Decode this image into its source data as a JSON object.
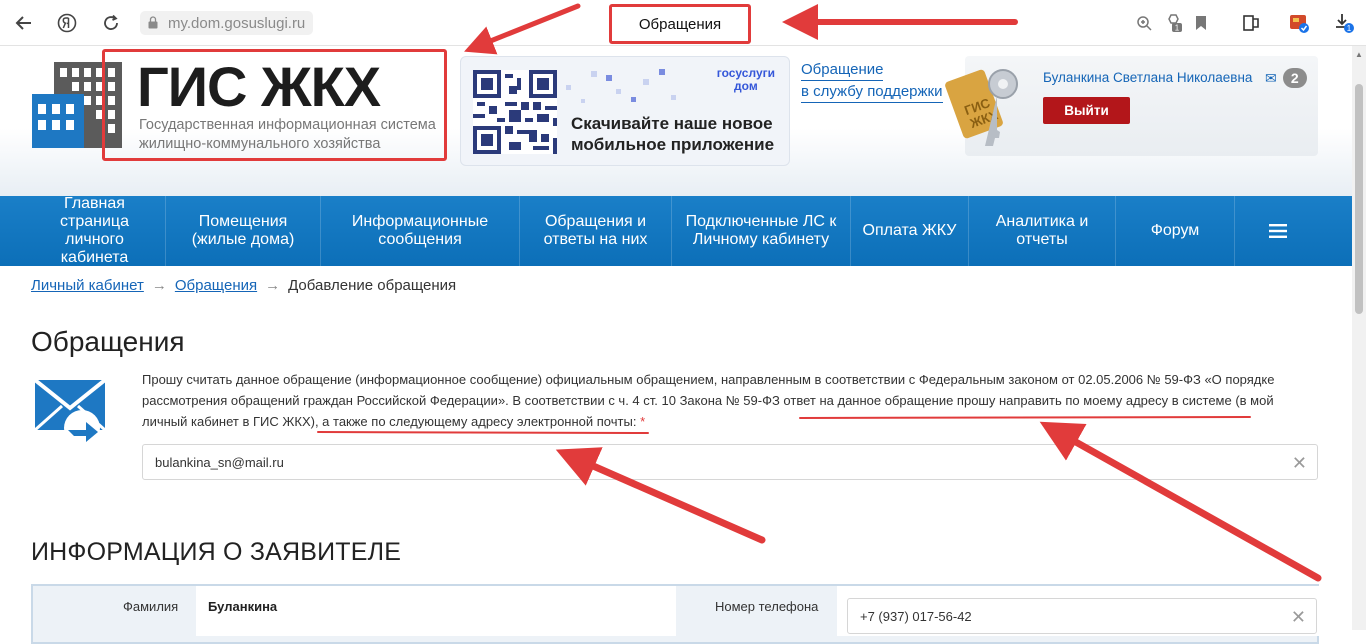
{
  "browser": {
    "url": "my.dom.gosuslugi.ru",
    "tab_title": "Обращения",
    "download_badge": "1",
    "ext_badge": "1"
  },
  "header": {
    "logo_title": "ГИС ЖКХ",
    "logo_subtitle": "Государственная информационная система жилищно-коммунального хозяйства",
    "promo_brand_line1": "госуслуги",
    "promo_brand_line2": "дом",
    "promo_text": "Скачивайте наше новое мобильное приложение",
    "support_line1": "Обращение",
    "support_line2": "в службу поддержки",
    "user_name": "Буланкина Светлана Николаевна",
    "messages_count": "2",
    "logout_label": "Выйти"
  },
  "nav": {
    "items": [
      "Главная страница личного кабинета",
      "Помещения (жилые дома)",
      "Информационные сообщения",
      "Обращения и ответы на них",
      "Подключенные ЛС к Личному кабинету",
      "Оплата ЖКУ",
      "Аналитика и отчеты",
      "Форум"
    ]
  },
  "breadcrumb": {
    "item1": "Личный кабинет",
    "item2": "Обращения",
    "current": "Добавление обращения",
    "sep": "→"
  },
  "main": {
    "title": "Обращения",
    "notice_part1": "Прошу считать данное обращение (информационное сообщение) официальным обращением, направленным в соответствии с Федеральным законом от 02.05.2006 № 59-ФЗ «О порядке рассмотрения обращений граждан Российской Федерации». В соответствии с ч. 4 ст. 10 Закона № 59-ФЗ ответ на данное обращение прошу направить по моему адресу в системе (в мой личный кабинет в ГИС ЖКХ), а также по следующему адресу электронной почты:",
    "required_mark": "*",
    "email_value": "bulankina_sn@mail.ru",
    "section_title": "ИНФОРМАЦИЯ О ЗАЯВИТЕЛЕ",
    "surname_label": "Фамилия",
    "surname_value": "Буланкина",
    "phone_label": "Номер телефона",
    "phone_value": "+7 (937) 017-56-42"
  },
  "colors": {
    "accent_blue": "#1565b7",
    "nav_blue": "#0c6fb8",
    "annotation_red": "#e13b3b",
    "logout_red": "#b3161a"
  }
}
